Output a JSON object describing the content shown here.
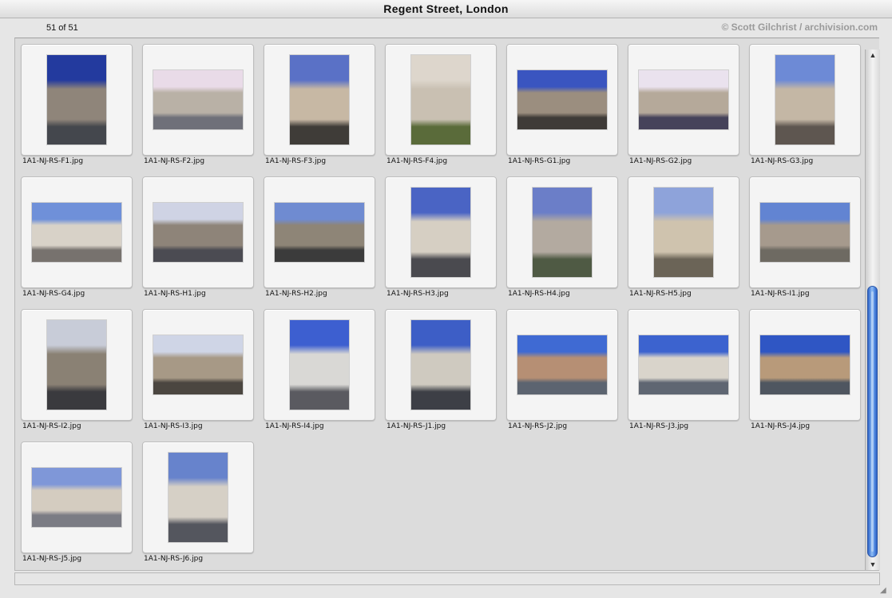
{
  "window": {
    "title": "Regent Street, London"
  },
  "header": {
    "count": "51 of 51",
    "copyright": "© Scott Gilchrist / archivision.com"
  },
  "scrollbar": {
    "up_arrow": "▲",
    "down_arrow": "▼"
  },
  "resize_handle": "◢",
  "thumbnails": [
    {
      "file": "1A1-NJ-RS-F1.jpg",
      "orientation": "portrait",
      "sky": "#233a9e",
      "mid": "#8f857a",
      "ground": "#44474d"
    },
    {
      "file": "1A1-NJ-RS-F2.jpg",
      "orientation": "landscape",
      "sky": "#e9dbe8",
      "mid": "#b9b1a6",
      "ground": "#6f7079"
    },
    {
      "file": "1A1-NJ-RS-F3.jpg",
      "orientation": "portrait",
      "sky": "#5a71c6",
      "mid": "#c7b8a4",
      "ground": "#3f3c38"
    },
    {
      "file": "1A1-NJ-RS-F4.jpg",
      "orientation": "portrait",
      "sky": "#ddd6cc",
      "mid": "#c9c0b2",
      "ground": "#5a6b3a"
    },
    {
      "file": "1A1-NJ-RS-G1.jpg",
      "orientation": "landscape",
      "sky": "#3a55c0",
      "mid": "#9b8e7f",
      "ground": "#3f3b38"
    },
    {
      "file": "1A1-NJ-RS-G2.jpg",
      "orientation": "landscape",
      "sky": "#eae2ee",
      "mid": "#b5a99a",
      "ground": "#46435a"
    },
    {
      "file": "1A1-NJ-RS-G3.jpg",
      "orientation": "portrait",
      "sky": "#6d8ad6",
      "mid": "#c4b7a5",
      "ground": "#5e5650"
    },
    {
      "file": "1A1-NJ-RS-G4.jpg",
      "orientation": "landscape",
      "sky": "#6f90d9",
      "mid": "#d8d2c8",
      "ground": "#77726e"
    },
    {
      "file": "1A1-NJ-RS-H1.jpg",
      "orientation": "landscape",
      "sky": "#cfd3e4",
      "mid": "#8e8479",
      "ground": "#4b4b52"
    },
    {
      "file": "1A1-NJ-RS-H2.jpg",
      "orientation": "landscape",
      "sky": "#6f8bd1",
      "mid": "#8e8577",
      "ground": "#3b3b3b"
    },
    {
      "file": "1A1-NJ-RS-H3.jpg",
      "orientation": "portrait",
      "sky": "#4a64c4",
      "mid": "#d6cfc3",
      "ground": "#4a4a4f"
    },
    {
      "file": "1A1-NJ-RS-H4.jpg",
      "orientation": "portrait",
      "sky": "#6b7ec8",
      "mid": "#b3aaa0",
      "ground": "#4f5a44"
    },
    {
      "file": "1A1-NJ-RS-H5.jpg",
      "orientation": "portrait",
      "sky": "#8ea3da",
      "mid": "#cfc3ae",
      "ground": "#6b6457"
    },
    {
      "file": "1A1-NJ-RS-I1.jpg",
      "orientation": "landscape",
      "sky": "#6284d2",
      "mid": "#a69a8d",
      "ground": "#6e6a62"
    },
    {
      "file": "1A1-NJ-RS-I2.jpg",
      "orientation": "portrait",
      "sky": "#c8ccd8",
      "mid": "#8a8174",
      "ground": "#3a3a3e"
    },
    {
      "file": "1A1-NJ-RS-I3.jpg",
      "orientation": "landscape",
      "sky": "#cfd5e6",
      "mid": "#a79986",
      "ground": "#4b4640"
    },
    {
      "file": "1A1-NJ-RS-I4.jpg",
      "orientation": "portrait",
      "sky": "#3d5fd0",
      "mid": "#d9d8d5",
      "ground": "#5a5a60"
    },
    {
      "file": "1A1-NJ-RS-J1.jpg",
      "orientation": "portrait",
      "sky": "#3d5ec6",
      "mid": "#cfcac0",
      "ground": "#3d3f46"
    },
    {
      "file": "1A1-NJ-RS-J2.jpg",
      "orientation": "landscape",
      "sky": "#3f6ad3",
      "mid": "#b68f74",
      "ground": "#5c6470"
    },
    {
      "file": "1A1-NJ-RS-J3.jpg",
      "orientation": "landscape",
      "sky": "#3c63cf",
      "mid": "#d9d4cb",
      "ground": "#5f6672"
    },
    {
      "file": "1A1-NJ-RS-J4.jpg",
      "orientation": "landscape",
      "sky": "#2f56c4",
      "mid": "#b89a7a",
      "ground": "#4f5660"
    },
    {
      "file": "1A1-NJ-RS-J5.jpg",
      "orientation": "landscape",
      "sky": "#7f97d8",
      "mid": "#d4ccc0",
      "ground": "#7b7c84"
    },
    {
      "file": "1A1-NJ-RS-J6.jpg",
      "orientation": "portrait",
      "sky": "#6783cc",
      "mid": "#d6d0c6",
      "ground": "#54565e"
    }
  ]
}
